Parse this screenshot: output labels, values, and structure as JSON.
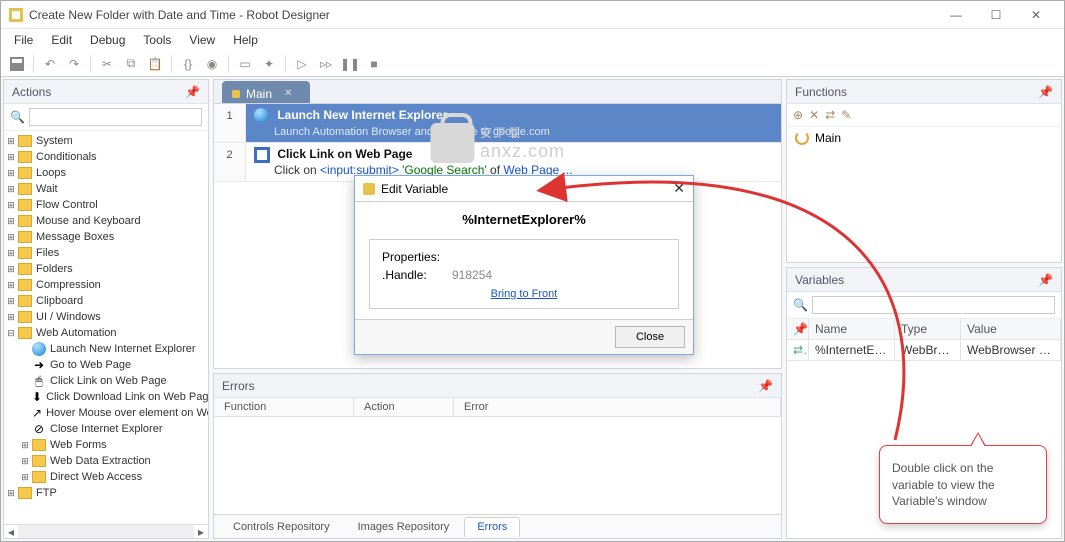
{
  "window": {
    "title": "Create New Folder with Date and Time - Robot Designer"
  },
  "menus": [
    "File",
    "Edit",
    "Debug",
    "Tools",
    "View",
    "Help"
  ],
  "panels": {
    "actions": "Actions",
    "errors": "Errors",
    "functions": "Functions",
    "variables": "Variables"
  },
  "tree": {
    "folders": [
      "System",
      "Conditionals",
      "Loops",
      "Wait",
      "Flow Control",
      "Mouse and Keyboard",
      "Message Boxes",
      "Files",
      "Folders",
      "Compression",
      "Clipboard",
      "UI / Windows"
    ],
    "webauto": "Web Automation",
    "webauto_children": [
      "Launch New Internet Explorer",
      "Go to Web Page",
      "Click Link on Web Page",
      "Click Download Link on Web Page",
      "Hover Mouse over element on Web Page",
      "Close Internet Explorer"
    ],
    "sub_folders": [
      "Web Forms",
      "Web Data Extraction",
      "Direct Web Access"
    ],
    "ftp": "FTP"
  },
  "tab": {
    "label": "Main"
  },
  "steps": {
    "s1": {
      "num": "1",
      "title": "Launch New Internet Explorer",
      "sub": "Launch Automation Browser and navigate to google.com"
    },
    "s2": {
      "num": "2",
      "title": "Click Link on Web Page",
      "sub_prefix": "Click on ",
      "sub_input": "<input:submit>",
      "sub_q": " 'Google Search'",
      "sub_of": " of ",
      "sub_wp": "Web Page",
      "sub_dots": "  ..."
    }
  },
  "modal": {
    "title": "Edit Variable",
    "varname": "%InternetExplorer%",
    "props_label": "Properties:",
    "handle_label": ".Handle:",
    "handle_value": "918254",
    "link": "Bring to Front",
    "close": "Close"
  },
  "errors": {
    "c1": "Function",
    "c2": "Action",
    "c3": "Error"
  },
  "bottom_tabs": {
    "t1": "Controls Repository",
    "t2": "Images Repository",
    "t3": "Errors"
  },
  "functions": {
    "item": "Main"
  },
  "variables": {
    "head": {
      "name": "Name",
      "type": "Type",
      "value": "Value"
    },
    "row": {
      "name": "%InternetEx...",
      "type": "WebBrow...",
      "value": "WebBrowser Instance"
    }
  },
  "callout": "Double click on the variable to view the Variable's window",
  "watermark": {
    "t1": "安下载",
    "t2": "anxz.com"
  }
}
